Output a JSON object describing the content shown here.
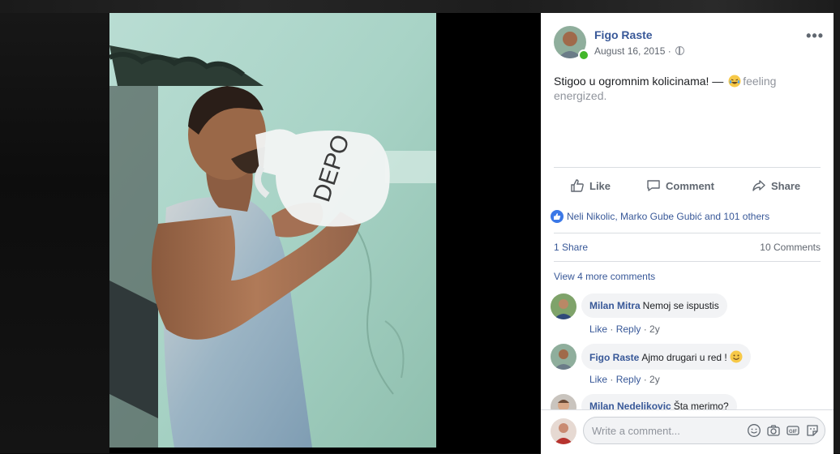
{
  "post": {
    "author": "Figo Raste",
    "date": "August 16, 2015 · ",
    "text": "Stigoo u ogromnim kolicinama! — ",
    "feeling": "feeling energized.",
    "more_icon": "more-horizontal-icon"
  },
  "photo": {
    "bottle_text": "DEPO"
  },
  "actions": {
    "like": "Like",
    "comment": "Comment",
    "share": "Share"
  },
  "reactions": {
    "text": "Neli Nikolic, Marko Gube Gubić and 101 others"
  },
  "stats": {
    "shares": "1 Share",
    "comments": "10 Comments"
  },
  "view_more": "View 4 more comments",
  "comments": [
    {
      "author": "Milan Mitra",
      "text": "Nemoj se ispustis",
      "like": "Like",
      "reply": "Reply",
      "age": "2y"
    },
    {
      "author": "Figo Raste",
      "text": "Ajmo drugari u red !",
      "like": "Like",
      "reply": "Reply",
      "age": "2y"
    },
    {
      "author": "Milan Nedelikovic",
      "text": "Šta merimo?",
      "like": "",
      "reply": "",
      "age": ""
    }
  ],
  "composer": {
    "placeholder": "Write a comment..."
  },
  "colors": {
    "link": "#385898",
    "online": "#42b72a",
    "like_blue": "#3b78e7"
  }
}
